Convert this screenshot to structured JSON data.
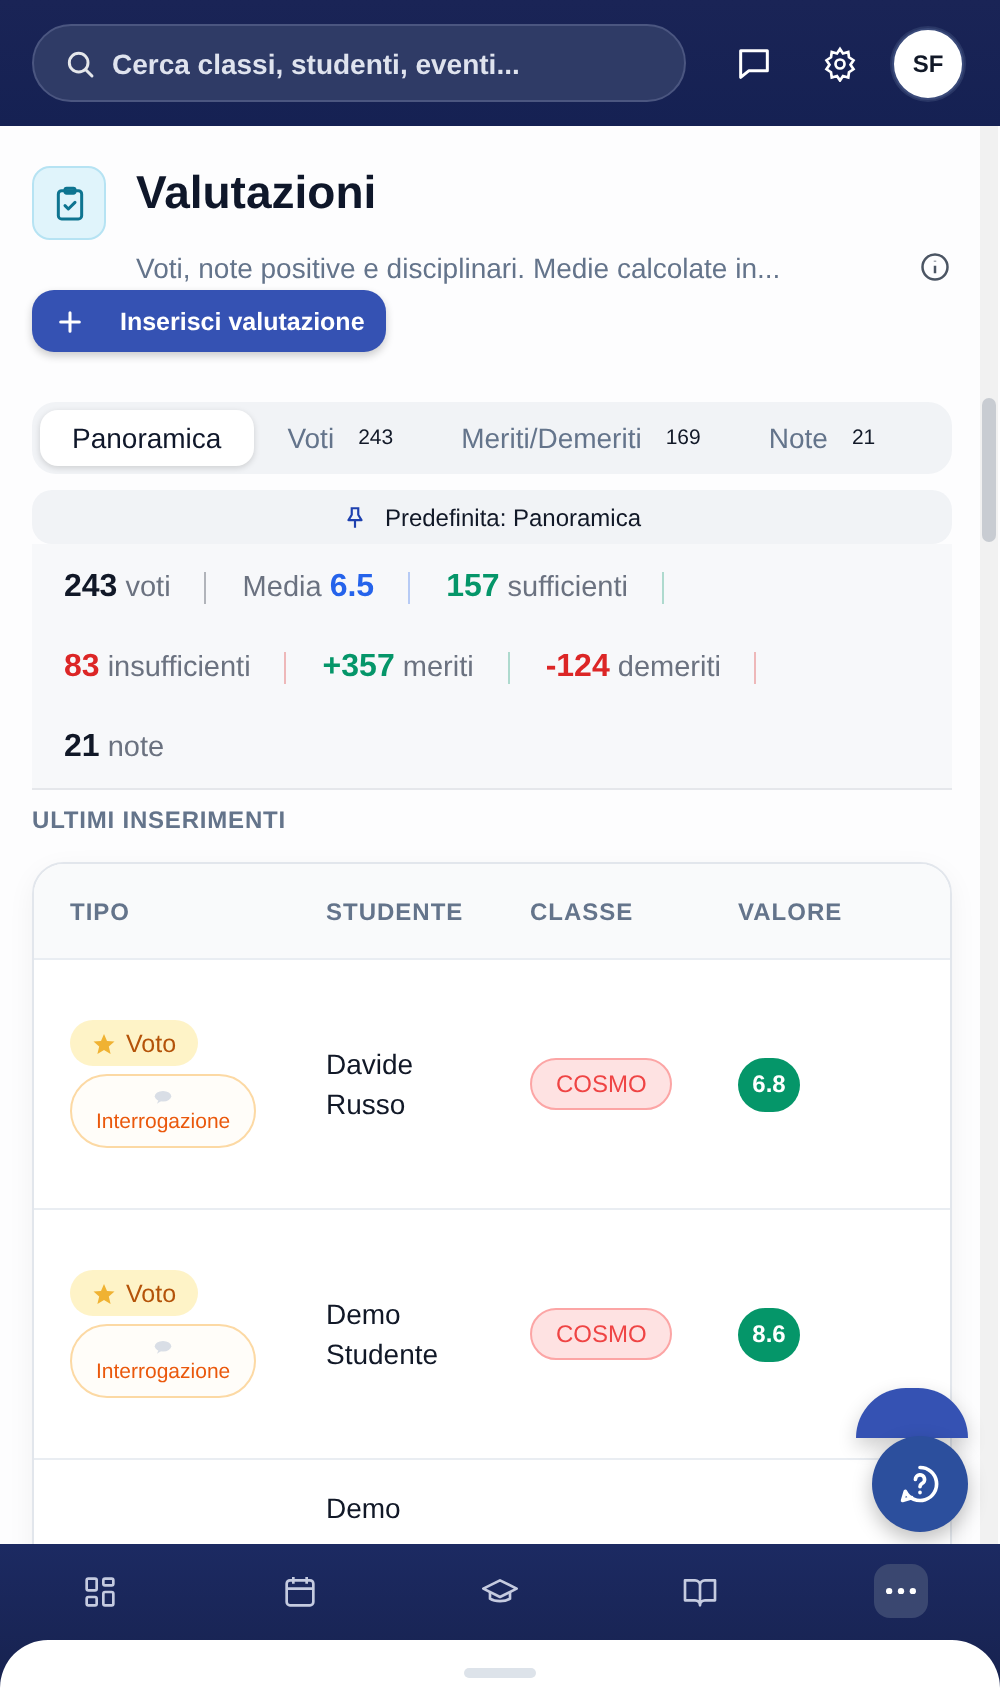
{
  "header": {
    "search": {
      "placeholder": "Cerca classi, studenti, eventi..."
    },
    "avatar": "SF"
  },
  "page": {
    "title": "Valutazioni",
    "subtitle": "Voti, note positive e disciplinari. Medie calcolate in...",
    "primary_button": "Inserisci valutazione"
  },
  "tabs": [
    {
      "label": "Panoramica",
      "selected": true
    },
    {
      "label": "Voti",
      "count": "243",
      "selected": false
    },
    {
      "label": "Meriti/Demeriti",
      "count": "169",
      "selected": false
    },
    {
      "label": "Note",
      "count": "21",
      "selected": false
    }
  ],
  "default_view": "Predefinita: Panoramica",
  "stats": [
    {
      "value": "243",
      "label": "voti",
      "color": "#111827"
    },
    {
      "label": "Media",
      "value": "6.5",
      "color": "#2563eb"
    },
    {
      "value": "157",
      "label": "sufficienti",
      "color": "#059669"
    },
    {
      "value": "83",
      "label": "insufficienti",
      "color": "#dc2626"
    },
    {
      "value": "+357",
      "label": "meriti",
      "color": "#059669"
    },
    {
      "value": "-124",
      "label": "demeriti",
      "color": "#dc2626"
    },
    {
      "value": "21",
      "label": "note",
      "color": "#111827"
    }
  ],
  "section_title": "ULTIMI INSERIMENTI",
  "table": {
    "columns": [
      "TIPO",
      "STUDENTE",
      "CLASSE",
      "VALORE"
    ],
    "rows": [
      {
        "type": "Voto",
        "subtype": "Interrogazione",
        "student": "Davide Russo",
        "class": "COSMO",
        "value": "6.8",
        "color": "#059669"
      },
      {
        "type": "Voto",
        "subtype": "Interrogazione",
        "student": "Demo Studente",
        "class": "COSMO",
        "value": "8.6",
        "color": "#059669"
      },
      {
        "student": "Demo"
      }
    ]
  },
  "bottom_nav": [
    {
      "selected": false
    },
    {
      "selected": false
    },
    {
      "selected": false
    },
    {
      "selected": false
    },
    {
      "selected": true
    }
  ]
}
